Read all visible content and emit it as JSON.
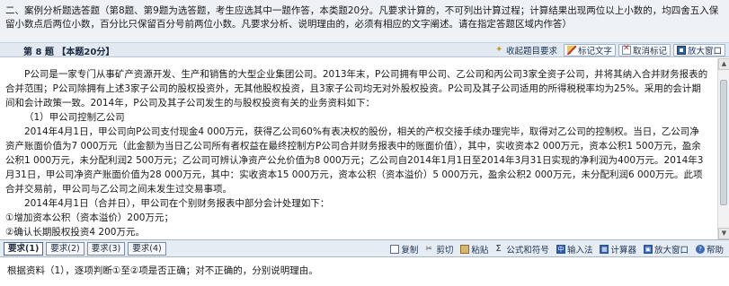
{
  "header": {
    "instructions": "二、案例分析题选答题（第8题、第9题为选答题，考生应选其中一题作答，本类题20分。凡要求计算的，不可列出计算过程；计算结果出现两位以上小数的，均四舍五入保留小数点后两位小数，百分比只保留百分号前两位小数。凡要求分析、说明理由的，必须有相应的文字阐述。请在指定答题区域内作答）"
  },
  "question_bar": {
    "label": "第 8 题",
    "score": "【本题20分】",
    "tools": [
      {
        "label": "收起题目要求",
        "icon": "star-icon"
      },
      {
        "label": "标记文字",
        "icon": "pen-icon"
      },
      {
        "label": "取消标记",
        "icon": "close-icon"
      },
      {
        "label": "放大窗口",
        "icon": "window-icon"
      }
    ]
  },
  "content": {
    "paragraphs": [
      "P公司是一家专门从事矿产资源开发、生产和销售的大型企业集团公司。2013年末，P公司拥有甲公司、乙公司和丙公司3家全资子公司，并将其纳入合并财务报表的合并范围；P公司除拥有上述3家子公司的股权投资外，无其他股权投资，且3家子公司均无对外股权投资。P公司及其子公司适用的所得税税率均为25%。采用的会计期间和会计政策一致。2014年，P公司及其子公司发生的与股权投资有关的业务资料如下：",
      "（1）甲公司控制乙公司",
      "2014年4月1日，甲公司向P公司支付现金4 000万元，获得乙公司60%有表决权的股份，相关的产权交接手续办理完毕，取得对乙公司的控制权。当日，乙公司净资产账面价值为7 000万元（此金额为当日乙公司所有者权益在最终控制方P公司合并财务报表中的账面价值），其中，实收资本2 000万元，资本公积1 500万元，盈余公积1 000万元，未分配利润2 500万元；乙公司可辨认净资产公允价值为8 000万元；乙公司自2014年1月1日至2014年3月31日实现的净利润为400万元。2014年3月31日，甲公司净资产账面价值为28 000万元，其中：实收资本15 000万元，资本公积（资本溢价）5 000万元，盈余公积2 000万元，未分配利润6 000万元。此项合并交易前，甲公司与乙公司之间未发生过交易事项。",
      "2014年4月1日（合并日），甲公司在个别财务报表中部分会计处理如下：",
      "①增加资本公积（资本溢价）200万元；",
      "②确认长期股权投资4 200万元。"
    ]
  },
  "tabs": [
    "要求(1)",
    "要求(2)",
    "要求(3)",
    "要求(4)"
  ],
  "answer_tools": [
    {
      "label": "复制",
      "icon": "copy-icon"
    },
    {
      "label": "剪切",
      "icon": "cut-icon"
    },
    {
      "label": "粘贴",
      "icon": "paste-icon"
    },
    {
      "label": "公式和符号",
      "icon": "sigma-icon"
    },
    {
      "label": "输入法",
      "icon": "input-method-icon",
      "badge": "中"
    },
    {
      "label": "计算器",
      "icon": "calculator-icon",
      "badge": "▦"
    },
    {
      "label": "放大窗口",
      "icon": "window-icon",
      "badge": "▣"
    },
    {
      "label": "帮助",
      "icon": "help-icon",
      "badge": "?"
    }
  ],
  "answer_prompt": "根据资料（1），逐项判断①至②项是否正确；对不正确的，分别说明理由。"
}
